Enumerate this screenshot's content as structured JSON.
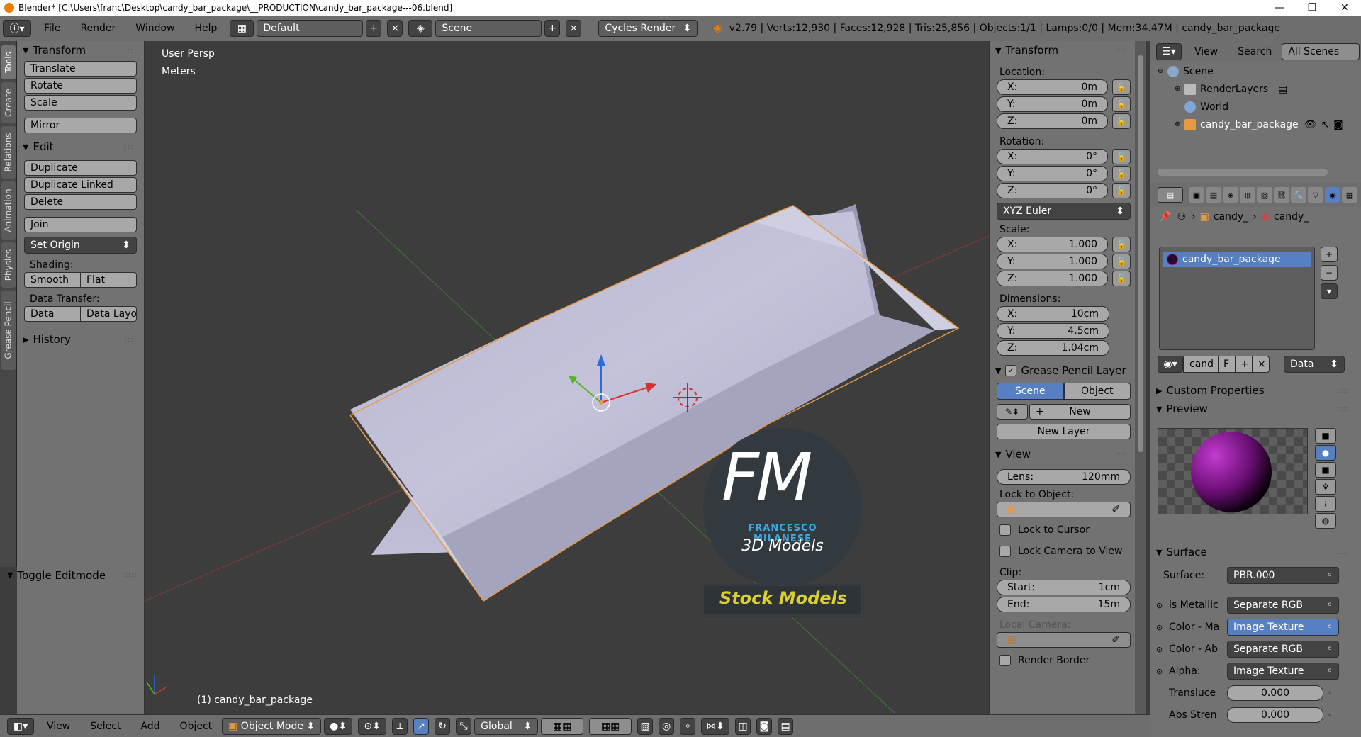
{
  "window": {
    "title": "Blender* [C:\\Users\\franc\\Desktop\\candy_bar_package\\__PRODUCTION\\candy_bar_package---06.blend]",
    "minimize": "—",
    "maximize": "❐",
    "close": "✕"
  },
  "info_header": {
    "menus": [
      "File",
      "Render",
      "Window",
      "Help"
    ],
    "layout": "Default",
    "scene": "Scene",
    "engine": "Cycles Render",
    "stats": "v2.79 | Verts:12,930 | Faces:12,928 | Tris:25,856 | Objects:1/1 | Lamps:0/0 | Mem:34.47M | candy_bar_package"
  },
  "tool_tabs": [
    "Tools",
    "Create",
    "Relations",
    "Animation",
    "Physics",
    "Grease Pencil"
  ],
  "toolshelf": {
    "transform_title": "Transform",
    "transform_buttons": [
      "Translate",
      "Rotate",
      "Scale"
    ],
    "mirror": "Mirror",
    "edit_title": "Edit",
    "edit_buttons": [
      "Duplicate",
      "Duplicate Linked",
      "Delete"
    ],
    "join": "Join",
    "set_origin": "Set Origin",
    "shading_label": "Shading:",
    "smooth": "Smooth",
    "flat": "Flat",
    "data_transfer_label": "Data Transfer:",
    "data": "Data",
    "data_layout": "Data Layo",
    "history_title": "History",
    "toggle_editmode": "Toggle Editmode"
  },
  "viewport": {
    "view_name": "User Persp",
    "units": "Meters",
    "object_label": "(1) candy_bar_package",
    "watermark_logo": "FM",
    "watermark_name": "FRANCESCO MILANESE",
    "watermark_sub": "3D Models",
    "watermark_banner": "Stock Models"
  },
  "npanel": {
    "transform_title": "Transform",
    "location_label": "Location:",
    "location": [
      {
        "axis": "X:",
        "value": "0m"
      },
      {
        "axis": "Y:",
        "value": "0m"
      },
      {
        "axis": "Z:",
        "value": "0m"
      }
    ],
    "rotation_label": "Rotation:",
    "rotation": [
      {
        "axis": "X:",
        "value": "0°"
      },
      {
        "axis": "Y:",
        "value": "0°"
      },
      {
        "axis": "Z:",
        "value": "0°"
      }
    ],
    "rotation_mode": "XYZ Euler",
    "scale_label": "Scale:",
    "scale": [
      {
        "axis": "X:",
        "value": "1.000"
      },
      {
        "axis": "Y:",
        "value": "1.000"
      },
      {
        "axis": "Z:",
        "value": "1.000"
      }
    ],
    "dimensions_label": "Dimensions:",
    "dimensions": [
      {
        "axis": "X:",
        "value": "10cm"
      },
      {
        "axis": "Y:",
        "value": "4.5cm"
      },
      {
        "axis": "Z:",
        "value": "1.04cm"
      }
    ],
    "grease_title": "Grease Pencil Layer",
    "grease_scene": "Scene",
    "grease_object": "Object",
    "grease_new": "New",
    "grease_new_layer": "New Layer",
    "view_title": "View",
    "lens_label": "Lens:",
    "lens_value": "120mm",
    "lock_object_label": "Lock to Object:",
    "lock_cursor": "Lock to Cursor",
    "lock_camera": "Lock Camera to View",
    "clip_label": "Clip:",
    "clip_start_label": "Start:",
    "clip_start": "1cm",
    "clip_end_label": "End:",
    "clip_end": "15m",
    "local_camera_label": "Local Camera:",
    "render_border": "Render Border"
  },
  "outliner": {
    "view": "View",
    "search": "Search",
    "all_scenes": "All Scenes",
    "items": [
      {
        "name": "Scene",
        "indent": 0
      },
      {
        "name": "RenderLayers",
        "indent": 1
      },
      {
        "name": "World",
        "indent": 1
      },
      {
        "name": "candy_bar_package",
        "indent": 1
      }
    ]
  },
  "properties": {
    "breadcrumb_obj": "candy_",
    "breadcrumb_mat": "candy_",
    "material_slot": "candy_bar_package",
    "material_name": "cand",
    "fake_user": "F",
    "link": "Data",
    "custom_props": "Custom Properties",
    "preview": "Preview",
    "surface_title": "Surface",
    "surface_label": "Surface:",
    "surface_value": "PBR.000",
    "inputs": [
      {
        "label": "is Metallic",
        "value": "Separate RGB",
        "blue": false
      },
      {
        "label": "Color - Ma",
        "value": "Image Texture",
        "blue": true
      },
      {
        "label": "Color - Ab",
        "value": "Separate RGB",
        "blue": false
      },
      {
        "label": "Alpha:",
        "value": "Image Texture",
        "blue": false
      }
    ],
    "translucent_label": "Transluce",
    "translucent_value": "0.000",
    "abs_label": "Abs Stren",
    "abs_value": "0.000"
  },
  "bottom_header": {
    "menus": [
      "View",
      "Select",
      "Add",
      "Object"
    ],
    "mode": "Object Mode",
    "orientation": "Global"
  },
  "colors": {
    "selected_blue": "#5680c2",
    "object_outline": "#e69a43",
    "axis_x": "#d8322e",
    "axis_y": "#56b324",
    "axis_z": "#2d6bd8",
    "banner_text": "#d8d032"
  },
  "icons": [
    "info-icon",
    "layout-icon",
    "scene-icon",
    "blender-logo-icon",
    "lock-icon",
    "eye-icon",
    "cursor-icon",
    "camera-icon",
    "material-sphere-icon",
    "eyedropper-icon",
    "pencil-icon",
    "plus-icon",
    "minus-icon"
  ]
}
